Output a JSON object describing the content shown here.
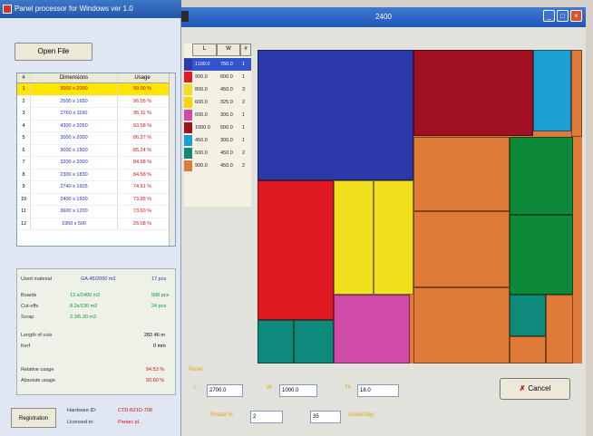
{
  "left_panel": {
    "title": "Panel processor for Windows ver 1.0",
    "open_button": "Open File",
    "table": {
      "headers": [
        "#",
        "Dimensions",
        "Usage"
      ],
      "rows": [
        {
          "n": "1",
          "dim": "3000 x 2000",
          "usage": "99.00 %",
          "selected": true
        },
        {
          "n": "2",
          "dim": "2500 x 1650",
          "usage": "96.55 %"
        },
        {
          "n": "3",
          "dim": "2760 x 1160",
          "usage": "95.11 %"
        },
        {
          "n": "4",
          "dim": "4300 x 2050",
          "usage": "93.58 %"
        },
        {
          "n": "5",
          "dim": "3000 x 2000",
          "usage": "86.37 %"
        },
        {
          "n": "6",
          "dim": "3000 x 1500",
          "usage": "85.24 %"
        },
        {
          "n": "7",
          "dim": "3200 x 2000",
          "usage": "84.98 %"
        },
        {
          "n": "8",
          "dim": "2300 x 1830",
          "usage": "84.58 %"
        },
        {
          "n": "9",
          "dim": "2740 x 1605",
          "usage": "74.91 %"
        },
        {
          "n": "10",
          "dim": "2400 x 1500",
          "usage": "73.95 %"
        },
        {
          "n": "11",
          "dim": "3600 x 1200",
          "usage": "73.60 %"
        },
        {
          "n": "12",
          "dim": "1950 x 500",
          "usage": "26.08 %"
        }
      ]
    },
    "stats": {
      "used_material_label": "Used material",
      "used_material_value": "GA.45/2000 m2",
      "used_material_pcs": "17 pcs",
      "boards_label": "Boards",
      "boards_value": "12.x/2400 m2",
      "boards_pcs": "998 pcs",
      "cutoffs_label": "Cut-offs",
      "cutoffs_value": "8.2x/130 m2",
      "cutoffs_pcs": "24 pcs",
      "scrap_label": "Scrap",
      "scrap_value": "2.3/6.30 m2",
      "cut_length_label": "Length of cuts",
      "cut_length_value": "282.46 m",
      "kerf_label": "Kerf",
      "kerf_value": "0 mm",
      "relative_usage_label": "Relative usage",
      "relative_usage_value": "94.53 %",
      "absolute_usage_label": "Absolute usage",
      "absolute_usage_value": "93.60 %"
    },
    "registration_button": "Registration",
    "footer": {
      "line1_label": "Hardware ID:",
      "line1_value": "CTD-B21D-798",
      "line2_label": "Licensed to:",
      "line2_value": "Pantec pl."
    }
  },
  "main_window": {
    "title": "2400",
    "dims_headers": [
      "L",
      "W",
      "#"
    ],
    "dims": [
      {
        "color": "#2b3aa8",
        "l": "1100.0",
        "w": "750.0",
        "q": "1"
      },
      {
        "color": "#e01a22",
        "l": "900.0",
        "w": "600.0",
        "q": "1"
      },
      {
        "color": "#f0e020",
        "l": "800.0",
        "w": "450.0",
        "q": "3"
      },
      {
        "color": "#ffd400",
        "l": "600.0",
        "w": "325.0",
        "q": "2"
      },
      {
        "color": "#d04aa8",
        "l": "600.0",
        "w": "300.0",
        "q": "1"
      },
      {
        "color": "#a01020",
        "l": "1000.0",
        "w": "500.0",
        "q": "1"
      },
      {
        "color": "#1aa0d0",
        "l": "450.0",
        "w": "300.0",
        "q": "1"
      },
      {
        "color": "#0e8a7a",
        "l": "500.0",
        "w": "450.0",
        "q": "2"
      },
      {
        "color": "#e07a38",
        "l": "900.0",
        "w": "450.0",
        "q": "2"
      }
    ],
    "params": {
      "group_label": "Panel",
      "l_label": "L",
      "l_value": "2700.0",
      "w_label": "W",
      "w_value": "1000.0",
      "thick_label": "Th",
      "thick_value": "18.0",
      "rotate_label": "Rotate %",
      "rotate_value": "2",
      "count_value": "35",
      "grain_label": "Grain/Step"
    },
    "cancel_button": "Cancel"
  },
  "colors": {
    "blue": "#2b3aa8",
    "red": "#e01a22",
    "yellow": "#f0e020",
    "magenta": "#d04aa8",
    "dark_red": "#a01020",
    "cyan": "#1aa0d0",
    "teal": "#0e8a7a",
    "orange": "#e07a38",
    "green": "#0c8a3a"
  }
}
